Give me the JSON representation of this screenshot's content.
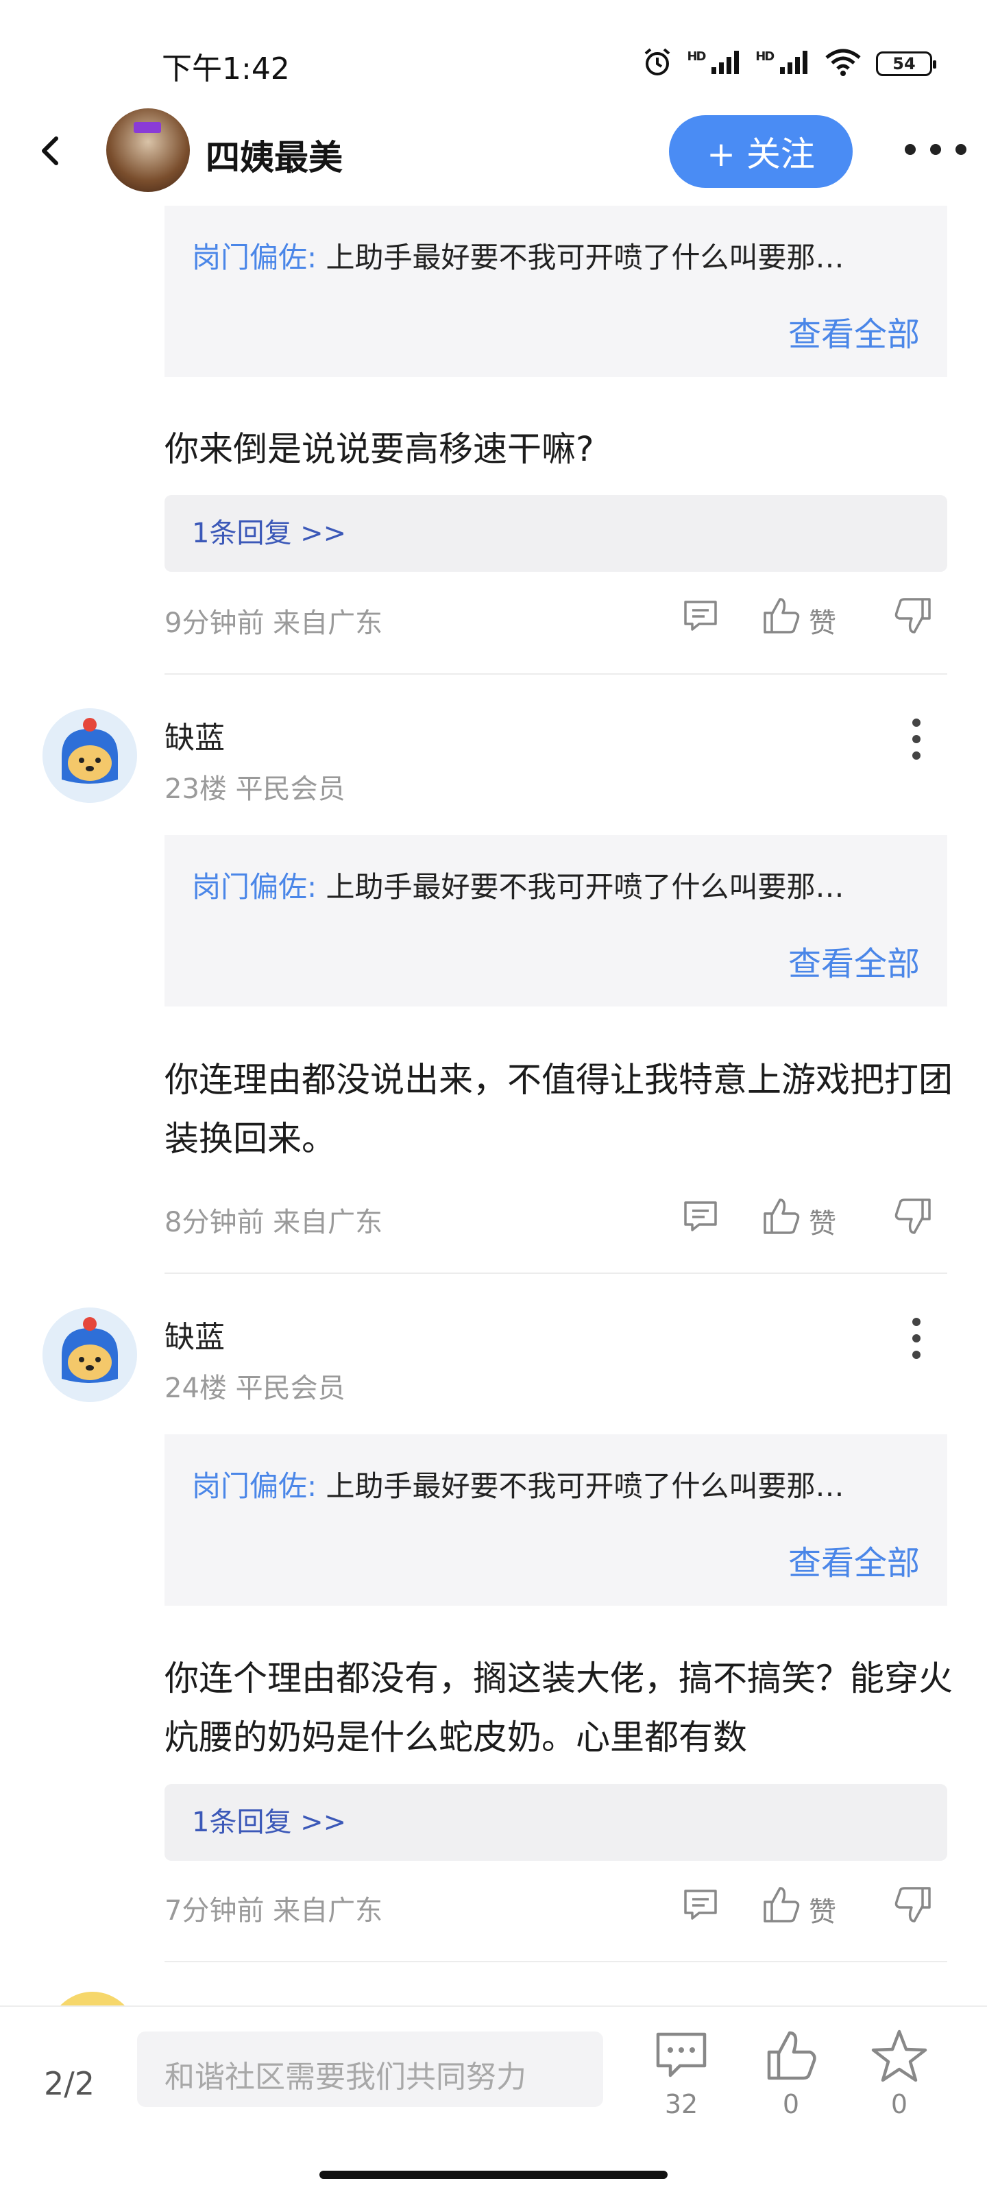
{
  "status_bar": {
    "time": "下午1:42",
    "hd1": "HD",
    "hd2": "HD",
    "battery": "54"
  },
  "header": {
    "title": "四姨最美",
    "follow_label": "+ 关注"
  },
  "posts": [
    {
      "quote_author": "岗门偏佐:",
      "quote_text": "上助手最好要不我可开喷了什么叫要那…",
      "view_all": "查看全部",
      "body": "你来倒是说说要高移速干嘛?",
      "replies": "1条回复 >>",
      "meta": "9分钟前 来自广东",
      "like_label": "赞"
    },
    {
      "username": "缺蓝",
      "floor": "23楼 平民会员",
      "quote_author": "岗门偏佐:",
      "quote_text": "上助手最好要不我可开喷了什么叫要那…",
      "view_all": "查看全部",
      "body": "你连理由都没说出来，不值得让我特意上游戏把打团装换回来。",
      "meta": "8分钟前 来自广东",
      "like_label": "赞"
    },
    {
      "username": "缺蓝",
      "floor": "24楼 平民会员",
      "quote_author": "岗门偏佐:",
      "quote_text": "上助手最好要不我可开喷了什么叫要那…",
      "view_all": "查看全部",
      "body": "你连个理由都没有，搁这装大佬，搞不搞笑？能穿火炕腰的奶妈是什么蛇皮奶。心里都有数",
      "replies": "1条回复 >>",
      "meta": "7分钟前 来自广东",
      "like_label": "赞"
    }
  ],
  "bottom_bar": {
    "page": "2/2",
    "placeholder": "和谐社区需要我们共同努力",
    "comments": "32",
    "likes": "0",
    "favorites": "0"
  },
  "colors": {
    "accent": "#4a8cf4",
    "link": "#4a86e8",
    "reply_link": "#3b58b8",
    "meta": "#9a9a9a"
  }
}
